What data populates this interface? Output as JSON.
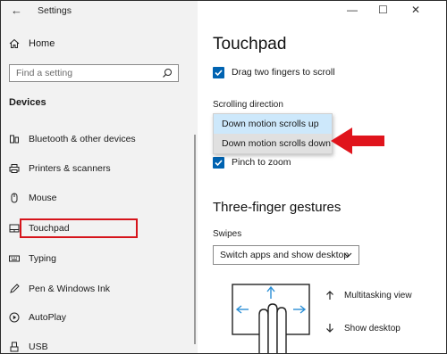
{
  "window": {
    "title": "Settings",
    "back_glyph": "←",
    "minimize_glyph": "—",
    "maximize_glyph": "☐",
    "close_glyph": "✕"
  },
  "sidebar": {
    "home_label": "Home",
    "search_placeholder": "Find a setting",
    "section_title": "Devices",
    "items": [
      {
        "label": "Bluetooth & other devices",
        "icon": "bluetooth-icon"
      },
      {
        "label": "Printers & scanners",
        "icon": "printer-icon"
      },
      {
        "label": "Mouse",
        "icon": "mouse-icon"
      },
      {
        "label": "Touchpad",
        "icon": "touchpad-icon",
        "selected": true
      },
      {
        "label": "Typing",
        "icon": "keyboard-icon"
      },
      {
        "label": "Pen & Windows Ink",
        "icon": "pen-icon"
      },
      {
        "label": "AutoPlay",
        "icon": "autoplay-icon"
      },
      {
        "label": "USB",
        "icon": "usb-icon"
      }
    ]
  },
  "main": {
    "title": "Touchpad",
    "drag_scroll_label": "Drag two fingers to scroll",
    "drag_scroll_checked": true,
    "scrolling_direction_label": "Scrolling direction",
    "scroll_options": [
      "Down motion scrolls up",
      "Down motion scrolls down"
    ],
    "pinch_zoom_label": "Pinch to zoom",
    "pinch_zoom_checked": true,
    "three_finger_title": "Three-finger gestures",
    "swipes_label": "Swipes",
    "swipes_value": "Switch apps and show desktop",
    "gesture_up_label": "Multitasking view",
    "gesture_down_label": "Show desktop"
  },
  "colors": {
    "accent": "#0063b1",
    "highlight_box": "#d6141b",
    "annotation_arrow": "#e0141c",
    "selected_option_bg": "#cde8fb"
  }
}
